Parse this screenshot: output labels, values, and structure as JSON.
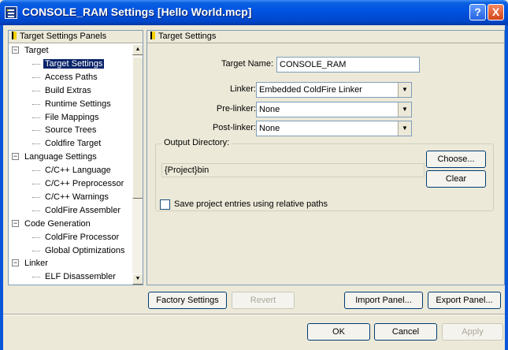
{
  "window": {
    "title": "CONSOLE_RAM Settings [Hello World.mcp]",
    "help_label": "?",
    "close_label": "X"
  },
  "tree": {
    "header": "Target Settings Panels",
    "rows": [
      {
        "label": "Target",
        "level": 0,
        "expanded": true
      },
      {
        "label": "Target Settings",
        "level": 1,
        "selected": true
      },
      {
        "label": "Access Paths",
        "level": 1
      },
      {
        "label": "Build Extras",
        "level": 1
      },
      {
        "label": "Runtime Settings",
        "level": 1
      },
      {
        "label": "File Mappings",
        "level": 1
      },
      {
        "label": "Source Trees",
        "level": 1
      },
      {
        "label": "Coldfire Target",
        "level": 1
      },
      {
        "label": "Language Settings",
        "level": 0,
        "expanded": true
      },
      {
        "label": "C/C++ Language",
        "level": 1
      },
      {
        "label": "C/C++ Preprocessor",
        "level": 1
      },
      {
        "label": "C/C++ Warnings",
        "level": 1
      },
      {
        "label": "ColdFire Assembler",
        "level": 1
      },
      {
        "label": "Code Generation",
        "level": 0,
        "expanded": true
      },
      {
        "label": "ColdFire Processor",
        "level": 1
      },
      {
        "label": "Global Optimizations",
        "level": 1
      },
      {
        "label": "Linker",
        "level": 0,
        "expanded": true
      },
      {
        "label": "ELF Disassembler",
        "level": 1
      }
    ]
  },
  "settings": {
    "header": "Target Settings",
    "target_name_label": "Target Name:",
    "target_name_value": "CONSOLE_RAM",
    "linker_label": "Linker:",
    "linker_value": "Embedded ColdFire Linker",
    "prelinker_label": "Pre-linker:",
    "prelinker_value": "None",
    "postlinker_label": "Post-linker:",
    "postlinker_value": "None",
    "output_dir_label": "Output Directory:",
    "output_dir_value": "{Project}bin",
    "choose_label": "Choose...",
    "clear_label": "Clear",
    "relative_paths_label": "Save project entries using relative paths",
    "relative_paths_checked": false
  },
  "panel_buttons": {
    "factory": "Factory Settings",
    "revert": "Revert",
    "import": "Import Panel...",
    "export": "Export Panel..."
  },
  "dialog_buttons": {
    "ok": "OK",
    "cancel": "Cancel",
    "apply": "Apply"
  }
}
